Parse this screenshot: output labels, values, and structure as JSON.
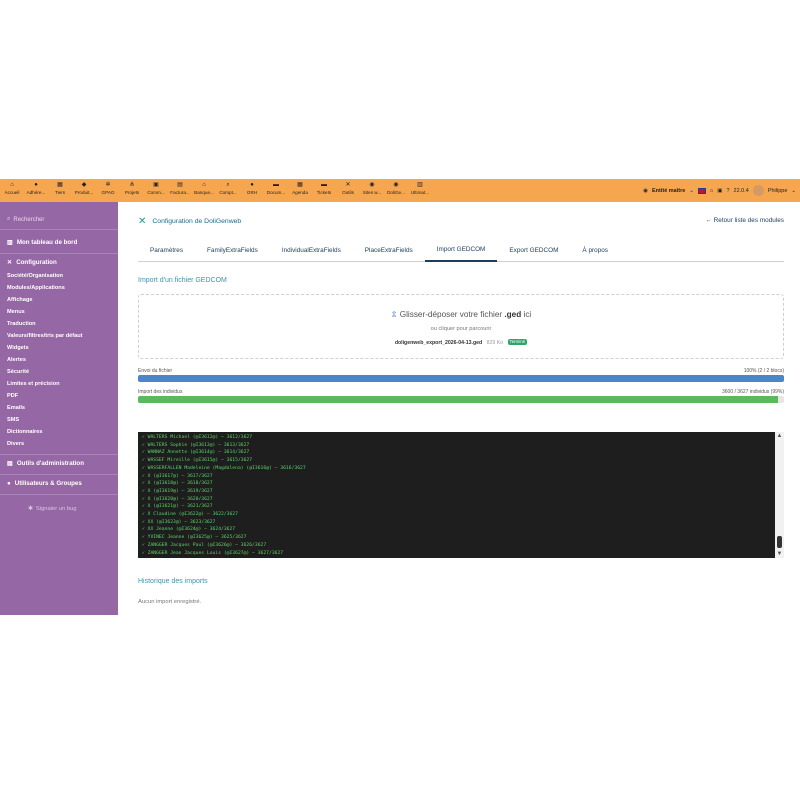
{
  "topbar": {
    "menus": [
      {
        "icon": "home-icon",
        "glyph": "⌂",
        "label": "Accueil"
      },
      {
        "icon": "members-icon",
        "glyph": "●",
        "label": "Adhére..."
      },
      {
        "icon": "thirdparty-icon",
        "glyph": "▦",
        "label": "Tiers"
      },
      {
        "icon": "product-icon",
        "glyph": "◆",
        "label": "Produit..."
      },
      {
        "icon": "gpao-icon",
        "glyph": "✲",
        "label": "GPAO"
      },
      {
        "icon": "project-icon",
        "glyph": "⋔",
        "label": "Projets"
      },
      {
        "icon": "commerce-icon",
        "glyph": "▣",
        "label": "Comm..."
      },
      {
        "icon": "invoice-icon",
        "glyph": "▤",
        "label": "Factura..."
      },
      {
        "icon": "bank-icon",
        "glyph": "⌂",
        "label": "Banque..."
      },
      {
        "icon": "accounting-icon",
        "glyph": "⌕",
        "label": "Compt..."
      },
      {
        "icon": "hr-icon",
        "glyph": "●",
        "label": "GRH"
      },
      {
        "icon": "documents-icon",
        "glyph": "▬",
        "label": "Docum..."
      },
      {
        "icon": "agenda-icon",
        "glyph": "▦",
        "label": "Agenda"
      },
      {
        "icon": "ticket-icon",
        "glyph": "▬",
        "label": "Tickets"
      },
      {
        "icon": "tools-icon",
        "glyph": "✕",
        "label": "Outils"
      },
      {
        "icon": "websites-icon",
        "glyph": "◉",
        "label": "Sites w..."
      },
      {
        "icon": "doligenweb-icon",
        "glyph": "◉",
        "label": "DoliGe..."
      },
      {
        "icon": "ultimate-icon",
        "glyph": "▥",
        "label": "Ultimat..."
      }
    ],
    "entity": "Entité maître",
    "version": "22.0.4",
    "user": "Philippe"
  },
  "sidebar": {
    "search_placeholder": "Rechercher",
    "dashboard": "Mon tableau de bord",
    "config_title": "Configuration",
    "config_items": [
      "Société/Organisation",
      "Modules/Applications",
      "Affichage",
      "Menus",
      "Traduction",
      "Valeurs/filtres/tris par défaut",
      "Widgets",
      "Alertes",
      "Sécurité",
      "Limites et précision",
      "PDF",
      "Emails",
      "SMS",
      "Dictionnaires",
      "Divers"
    ],
    "admin_tools": "Outils d'administration",
    "users_groups": "Utilisateurs & Groupes",
    "report_bug": "Signaler un bug"
  },
  "main": {
    "module_title": "Configuration de DoliGenweb",
    "back_link": "Retour liste des modules",
    "tabs": [
      "Paramètres",
      "FamilyExtraFields",
      "IndividualExtraFields",
      "PlaceExtraFields",
      "Import GEDCOM",
      "Export GEDCOM",
      "À propos"
    ],
    "import_title": "Import d'un fichier GEDCOM",
    "dropzone": {
      "main_prefix": "Glisser-déposer votre fichier",
      "ext": ".ged",
      "main_suffix": "ici",
      "sub": "ou cliquer pour parcourir",
      "filename": "doligenweb_export_2026-04-13.ged",
      "size": "829 Ko",
      "status_badge": "Terminé"
    },
    "upload": {
      "label": "Envoi du fichier",
      "status": "100% (2 / 2 blocs)",
      "fraction": 1.0
    },
    "individuals": {
      "label": "Import des individus",
      "status": "3600 / 3627 individus (99%)",
      "fraction": 0.99
    },
    "log_lines": [
      "✓ WALTERS Michael (@I3612@) — 3612/3627",
      "✓ WALTERS Sophie (@I3613@) — 3613/3627",
      "✓ WANNAZ Annette (@I3614@) — 3614/3627",
      "✓ WASSEF Mireille (@I3615@) — 3615/3627",
      "✓ WASSERFALLEN Madeleine (Magdalena) (@I3616@) — 3616/3627",
      "✓ X (@I3617@) — 3617/3627",
      "✓ X (@I3618@) — 3618/3627",
      "✓ X (@I3619@) — 3619/3627",
      "✓ X (@I3620@) — 3620/3627",
      "✓ X (@I3621@) — 3621/3627",
      "✓ X Claudine (@I3622@) — 3622/3627",
      "✓ XX (@I3623@) — 3623/3627",
      "✓ XX Jeanne (@I3624@) — 3624/3627",
      "✓ YVINEC Jeanne (@I3625@) — 3625/3627",
      "✓ ZANGGER Jacques Paul (@I3626@) — 3626/3627",
      "✓ ZANGGER Jean Jacques Louis (@I3627@) — 3627/3627"
    ],
    "history_title": "Historique des imports",
    "history_empty": "Aucun import enregistré.",
    "colors": {
      "topbar": "#f7a650",
      "sidebar": "#9667a5",
      "upload_bar": "#4a86c8",
      "individuals_bar": "#5cb85c",
      "console_bg": "#1e1e1e",
      "console_text": "#5ed36a"
    }
  }
}
